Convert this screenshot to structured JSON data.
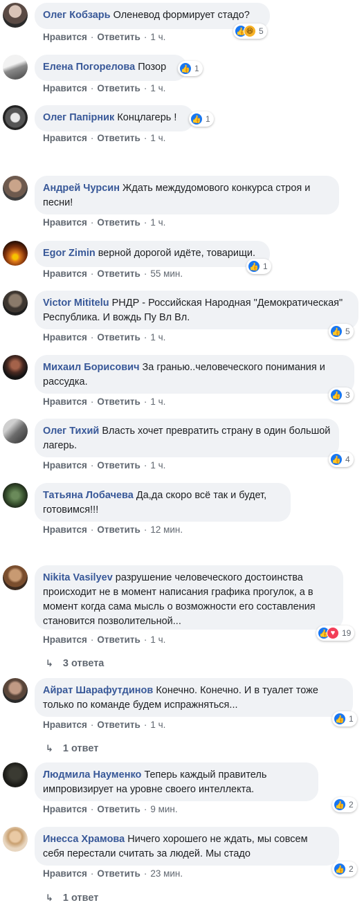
{
  "actions": {
    "like": "Нравится",
    "reply": "Ответить",
    "dot": "·"
  },
  "comments": [
    {
      "name": "Олег Кобзарь",
      "text": "Оленевод формирует стадо?",
      "time": "1 ч.",
      "reactions": "5",
      "icons": [
        "like-icon",
        "haha-icon"
      ]
    },
    {
      "name": "Елена Погорелова",
      "text": "Позор",
      "time": "1 ч.",
      "reactions": "1",
      "icons": [
        "like-icon"
      ]
    },
    {
      "name": "Олег Папірник",
      "text": "Концлагерь !",
      "time": "1 ч.",
      "reactions": "1",
      "icons": [
        "like-icon"
      ]
    },
    {
      "name": "Андрей Чурсин",
      "text": "Ждать междудомового конкурса строя и песни!",
      "time": "1 ч."
    },
    {
      "name": "Egor Zimin",
      "text": "верной дорогой идёте, товарищи.",
      "time": "55 мин.",
      "reactions": "1",
      "icons": [
        "like-icon"
      ]
    },
    {
      "name": "Victor Mititelu",
      "text": "РНДР - Российская Народная \"Демократическая\" Республика. И вождь Пу Вл Вл.",
      "time": "1 ч.",
      "reactions": "5",
      "icons": [
        "like-icon"
      ]
    },
    {
      "name": "Михаил Борисович",
      "text": "За гранью..человеческого понимания и рассудка.",
      "time": "1 ч.",
      "reactions": "3",
      "icons": [
        "like-icon"
      ]
    },
    {
      "name": "Олег Тихий",
      "text": "Власть хочет превратить страну в один большой лагерь.",
      "time": "1 ч.",
      "reactions": "4",
      "icons": [
        "like-icon"
      ]
    },
    {
      "name": "Татьяна Лобачева",
      "text": "Да,да скоро всё так и будет, готовимся!!!",
      "time": "12 мин."
    },
    {
      "name": "Nikita Vasilyev",
      "text": "разрушение человеческого достоинства происходит не в момент написания графика прогулок, а в момент когда сама мысль о возможности его составления становится позволительной...",
      "time": "1 ч.",
      "reactions": "19",
      "icons": [
        "like-icon",
        "love-icon"
      ],
      "replies": "3 ответа"
    },
    {
      "name": "Айрат Шарафутдинов",
      "text": "Конечно. Конечно. И в туалет тоже только по команде будем испражняться...",
      "time": "1 ч.",
      "reactions": "1",
      "icons": [
        "like-icon"
      ],
      "replies": "1 ответ"
    },
    {
      "name": "Людмила Науменко",
      "text": "Теперь каждый правитель импровизирует на уровне своего интеллекта.",
      "time": "9 мин.",
      "reactions": "2",
      "icons": [
        "like-icon"
      ]
    },
    {
      "name": "Инесса Храмова",
      "text": "Ничего хорошего не ждать, мы совсем себя перестали считать за людей. Мы стадо",
      "time": "23 мин.",
      "reactions": "2",
      "icons": [
        "like-icon"
      ],
      "replies": "1 ответ"
    }
  ]
}
